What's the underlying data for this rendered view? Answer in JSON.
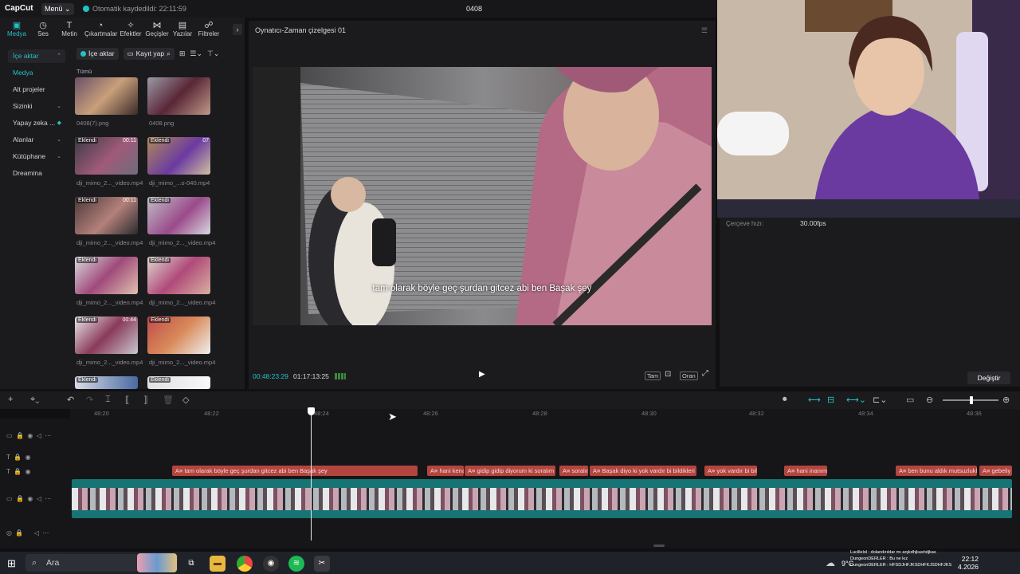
{
  "app": {
    "logo": "CapCut",
    "menu_label": "Menü ⌄",
    "autosave": "Otomatik kaydedildi: 22:11:59",
    "project_name": "0408"
  },
  "toolbar": {
    "items": [
      {
        "label": "Medya",
        "icon": "media-icon"
      },
      {
        "label": "Ses",
        "icon": "audio-icon"
      },
      {
        "label": "Metin",
        "icon": "text-icon"
      },
      {
        "label": "Çıkartmalar",
        "icon": "sticker-icon"
      },
      {
        "label": "Efektler",
        "icon": "effects-icon"
      },
      {
        "label": "Geçişler",
        "icon": "transitions-icon"
      },
      {
        "label": "Yazılar",
        "icon": "captions-icon"
      },
      {
        "label": "Filtreler",
        "icon": "filters-icon"
      }
    ]
  },
  "leftnav": {
    "items": [
      "İçe aktar",
      "Medya",
      "Alt projeler",
      "Sizinki",
      "Yapay zeka ...",
      "Alanlar",
      "Kütüphane",
      "Dreamina"
    ]
  },
  "media": {
    "import_label": "İçe aktar",
    "record_label": "Kayıt yap",
    "section": "Tümü",
    "items": [
      {
        "caption": "0408(7).png",
        "badge": "",
        "duration": ""
      },
      {
        "caption": "0408.png",
        "badge": "",
        "duration": ""
      },
      {
        "caption": "dji_mimo_2..._video.mp4",
        "badge": "Eklendi",
        "duration": "00:11"
      },
      {
        "caption": "dji_mimo_...o-040.mp4",
        "badge": "Eklendi",
        "duration": "07"
      },
      {
        "caption": "dji_mimo_2..._video.mp4",
        "badge": "Eklendi",
        "duration": "00:11"
      },
      {
        "caption": "dji_mimo_2..._video.mp4",
        "badge": "Eklendi",
        "duration": ""
      },
      {
        "caption": "dji_mimo_2..._video.mp4",
        "badge": "Eklendi",
        "duration": ""
      },
      {
        "caption": "dji_mimo_2..._video.mp4",
        "badge": "Eklendi",
        "duration": ""
      },
      {
        "caption": "dji_mimo_2..._video.mp4",
        "badge": "Eklendi",
        "duration": "00:44"
      },
      {
        "caption": "dji_mimo_2..._video.mp4",
        "badge": "Eklendi",
        "duration": ""
      },
      {
        "caption": "",
        "badge": "Eklendi",
        "duration": ""
      },
      {
        "caption": "",
        "badge": "Eklendi",
        "duration": ""
      }
    ]
  },
  "player": {
    "title": "Oynatıcı-Zaman çizelgesi 01",
    "subtitle": "tam olarak böyle geç şurdan gitcez abi ben Başak şey",
    "current_time": "00:48:23:29",
    "total_time": "01:17:13:25",
    "buttons": [
      "Tam",
      "Oran"
    ]
  },
  "properties": {
    "fps_label": "Çerçeve hızı:",
    "fps_value": "30.00fps",
    "change_label": "Değiştir"
  },
  "timeline": {
    "ruler": [
      "48:20",
      "48:22",
      "48:24",
      "48:26",
      "48:28",
      "48:30",
      "48:32",
      "48:34",
      "48:36"
    ],
    "segments": [
      {
        "text": "tam olarak böyle geç şurdan gitcez abi ben Başak şey"
      },
      {
        "text": "hani kena"
      },
      {
        "text": "gidip gidip diyorum ki soralım mı"
      },
      {
        "text": "soralım"
      },
      {
        "text": "Başak diyo ki yok vardır bi bildikleri"
      },
      {
        "text": "yok vardır bi bildi"
      },
      {
        "text": "hani inanıma"
      },
      {
        "text": "ben bunu aldık mutsuzluklar"
      },
      {
        "text": "gebeliy"
      }
    ]
  },
  "taskbar": {
    "search": "Ara",
    "weather": "9°C",
    "time": "22:12",
    "date": "4.2026",
    "chat": [
      "Lucillelol : dolandırıldar mı arşkdhjkashdjkas",
      "DungeonDERLER : Bu ne kız",
      "DungeonDERLER : HFSDJHFJKSDHFKJSDHFJKS"
    ]
  }
}
